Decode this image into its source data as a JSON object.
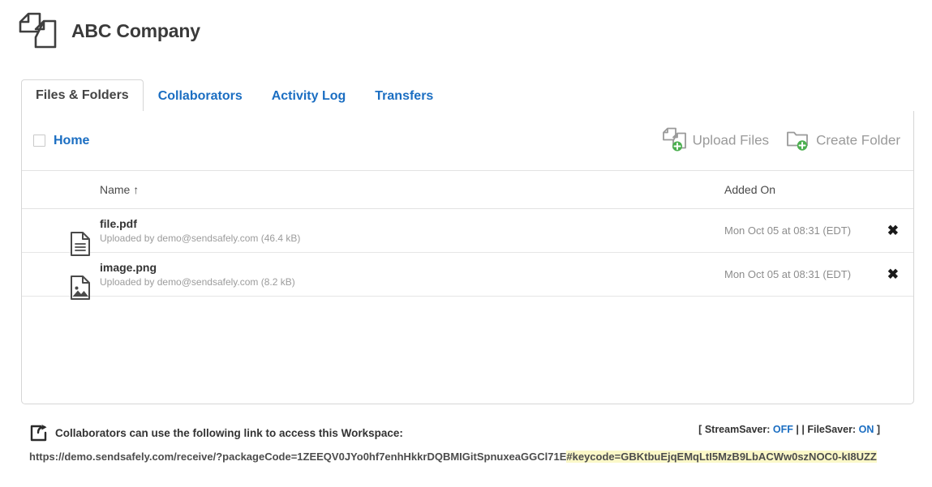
{
  "header": {
    "company": "ABC Company",
    "logo_icon": "two-documents-icon"
  },
  "tabs": [
    {
      "label": "Files & Folders",
      "active": true
    },
    {
      "label": "Collaborators",
      "active": false
    },
    {
      "label": "Activity Log",
      "active": false
    },
    {
      "label": "Transfers",
      "active": false
    }
  ],
  "toolbar": {
    "home_label": "Home",
    "upload_label": "Upload Files",
    "upload_icon": "upload-files-icon",
    "create_folder_label": "Create Folder",
    "create_folder_icon": "create-folder-icon",
    "accent_green": "#4caf50"
  },
  "table": {
    "columns": {
      "name": "Name",
      "sort_arrow": "↑",
      "added_on": "Added On"
    },
    "rows": [
      {
        "icon": "pdf-file-icon",
        "name": "file.pdf",
        "subtitle": "Uploaded by demo@sendsafely.com (46.4 kB)",
        "added_on": "Mon Oct 05 at 08:31 (EDT)",
        "delete_icon": "✖"
      },
      {
        "icon": "image-file-icon",
        "name": "image.png",
        "subtitle": "Uploaded by demo@sendsafely.com (8.2 kB)",
        "added_on": "Mon Oct 05 at 08:31 (EDT)",
        "delete_icon": "✖"
      }
    ]
  },
  "footer": {
    "share_icon": "share-link-icon",
    "note": "Collaborators can use the following link to access this Workspace:",
    "url_base": "https://demo.sendsafely.com/receive/?packageCode=1ZEEQV0JYo0hf7enhHkkrDQBMIGitSpnuxeaGGCl71E",
    "url_keycode": "#keycode=GBKtbuEjqEMqLtI5MzB9LbACWw0szNOC0-kI8UZZ",
    "savers": {
      "open_bracket": "[",
      "stream_label": "StreamSaver:",
      "stream_value": "OFF",
      "separator": "|  |",
      "file_label": "FileSaver:",
      "file_value": "ON",
      "close_bracket": "]"
    }
  }
}
